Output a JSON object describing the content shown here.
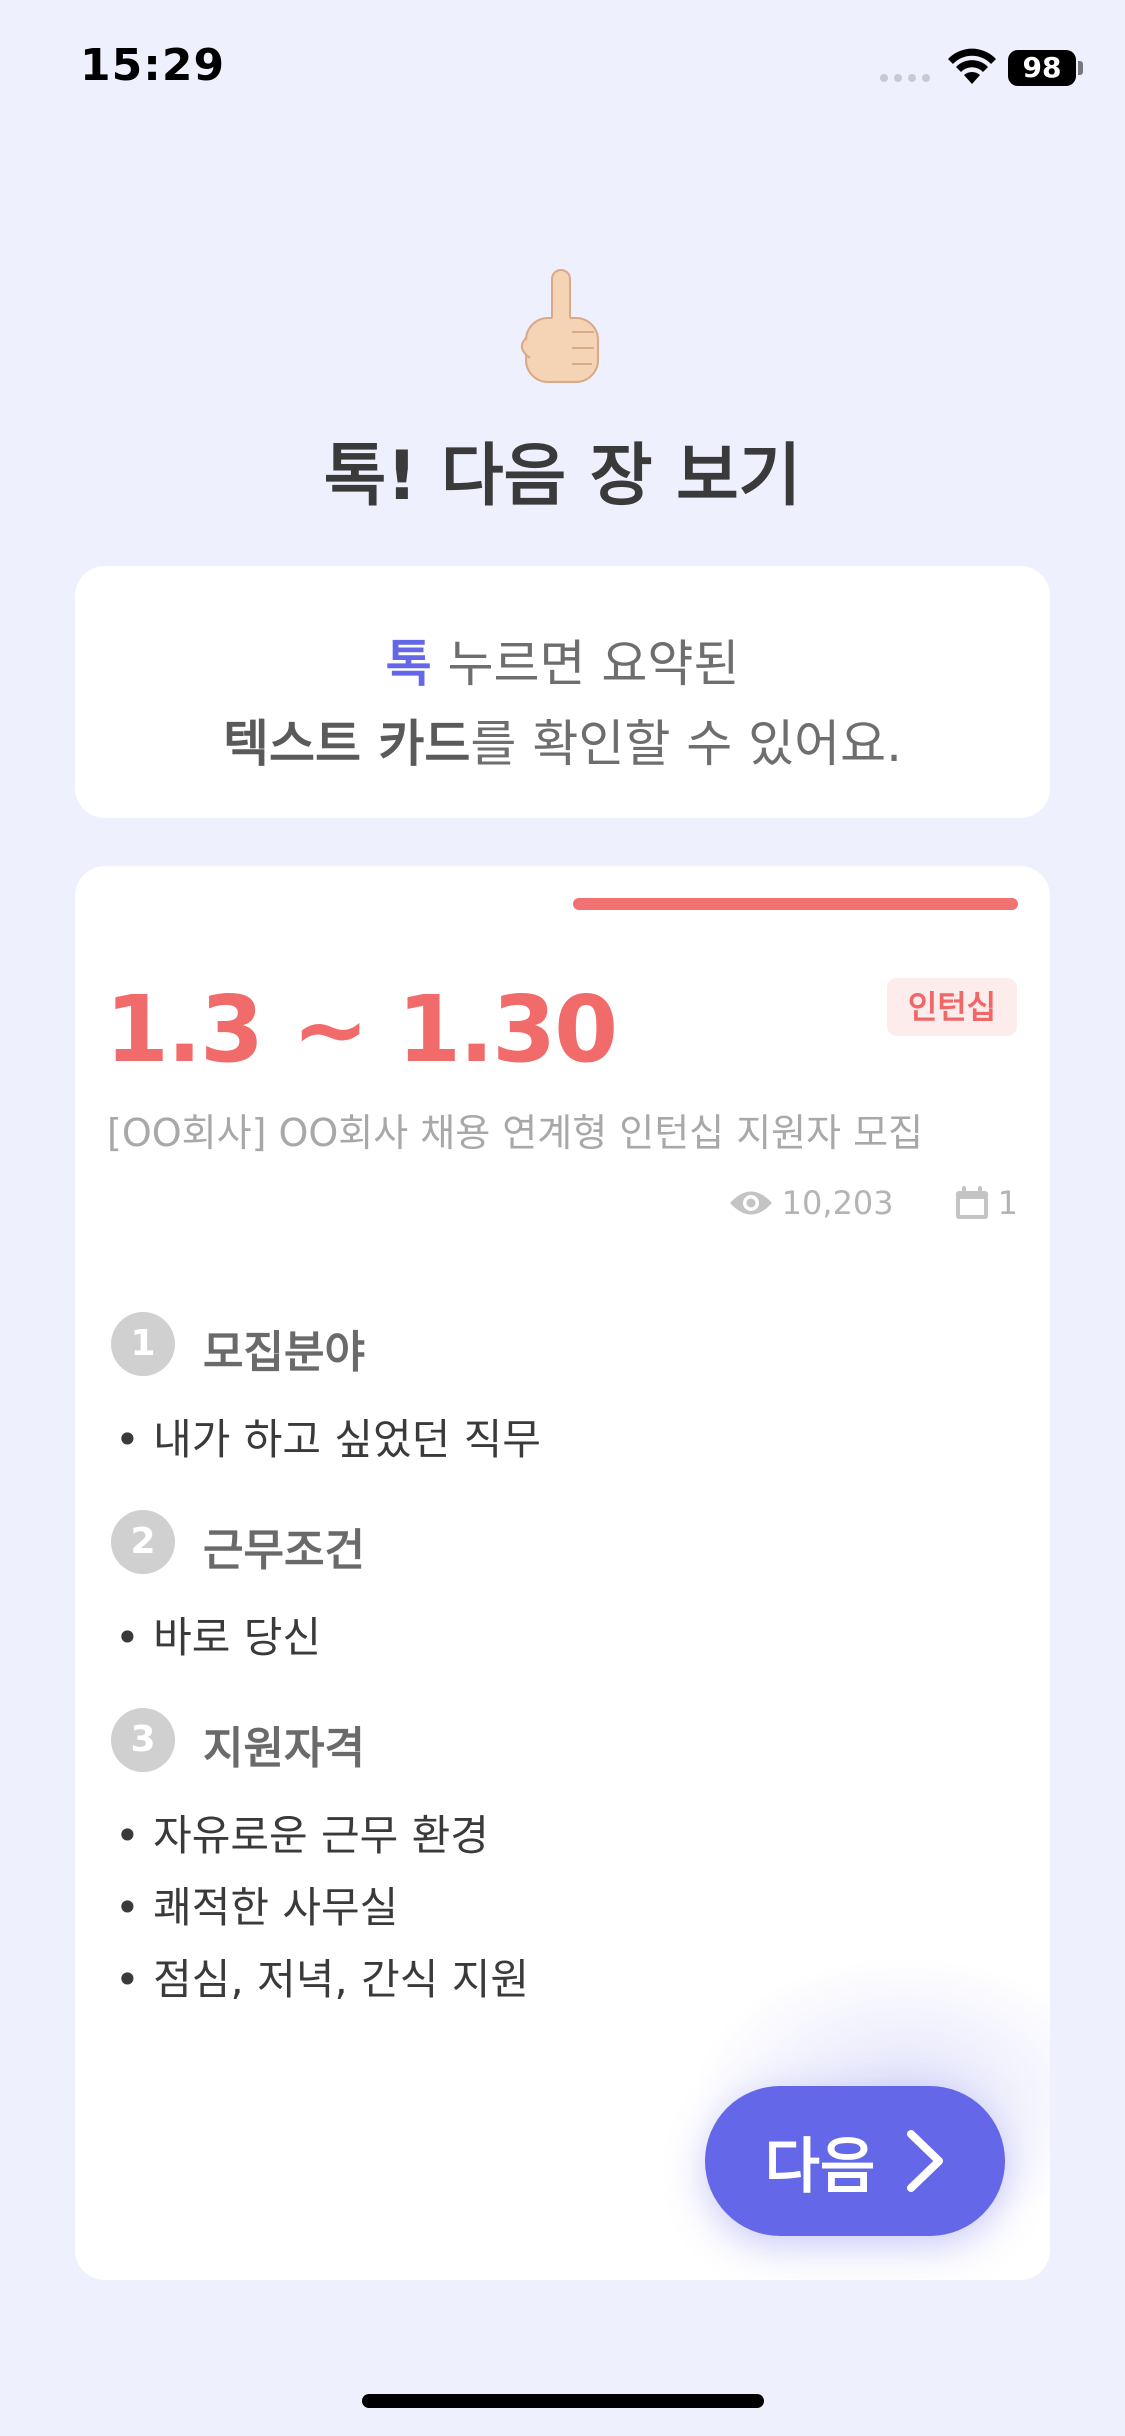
{
  "status_bar": {
    "time": "15:29",
    "battery": "98"
  },
  "header": {
    "title": "톡! 다음 장 보기"
  },
  "hint": {
    "line1_accent": "톡",
    "line1_rest": " 누르면 요약된",
    "line2_strong": "텍스트 카드",
    "line2_rest": "를 확인할 수 있어요."
  },
  "card": {
    "progress": 0.5,
    "date_range": "1.3 ~ 1.30",
    "category": "인턴십",
    "title": "[OO회사] OO회사 채용 연계형 인턴십 지원자 모집",
    "views": "10,203",
    "scraps": "1",
    "sections": [
      {
        "num": "1",
        "title": "모집분야",
        "items": [
          "• 내가 하고 싶었던 직무"
        ]
      },
      {
        "num": "2",
        "title": "근무조건",
        "items": [
          "• 바로 당신"
        ]
      },
      {
        "num": "3",
        "title": "지원자격",
        "items": [
          "• 자유로운 근무 환경",
          "• 쾌적한 사무실",
          "• 점심, 저녁, 간식 지원"
        ]
      }
    ],
    "next_label": "다음"
  },
  "colors": {
    "accent": "#6367E8",
    "highlight": "#F26B6B",
    "background": "#EEF0FD"
  },
  "icons": [
    "hand-pointing-up-icon",
    "eye-icon",
    "calendar-icon",
    "chevron-right-icon",
    "wifi-icon"
  ]
}
